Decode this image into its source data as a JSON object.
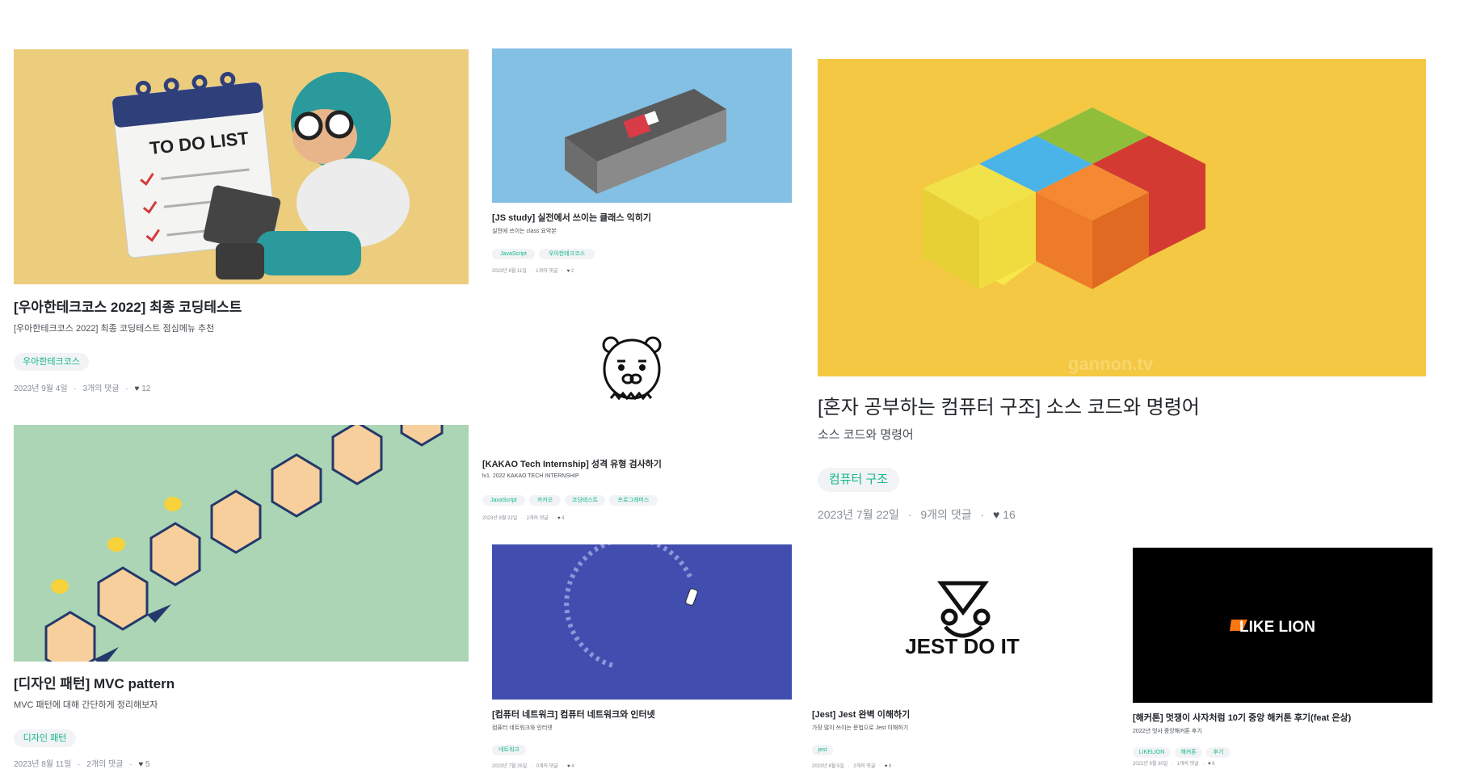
{
  "posts": [
    {
      "title": "[우아한테크코스 2022] 최종 코딩테스트",
      "desc": "[우아한테크코스 2022] 최종 코딩테스트 점심메뉴 추천",
      "tags": [
        "우아한테크코스"
      ],
      "date": "2023년 9월 4일",
      "comments": "3개의 댓글",
      "likes": "12",
      "thumb_text": "TO DO LIST"
    },
    {
      "title": "[디자인 패턴] MVC pattern",
      "desc": "MVC 패턴에 대해 간단하게 정리해보자",
      "tags": [
        "디자인 패턴"
      ],
      "date": "2023년 8월 11일",
      "comments": "2개의 댓글",
      "likes": "5"
    },
    {
      "title": "[JS study] 실전에서 쓰이는 클래스 익히기",
      "desc": "실전에 쓰이는 class 요약본",
      "tags": [
        "JavaScript",
        "우아한테크코스"
      ],
      "date": "2023년 8월 11일",
      "comments": "1개의 댓글",
      "likes": "2"
    },
    {
      "title": "[KAKAO Tech Internship] 성격 유형 검사하기",
      "desc": "lv1. 2022 KAKAO TECH INTERNSHIP",
      "tags": [
        "JavaScript",
        "카카오",
        "코딩테스트",
        "프로그래머스"
      ],
      "date": "2023년 8월 22일",
      "comments": "2개의 댓글",
      "likes": "4"
    },
    {
      "title": "[컴퓨터 네트워크] 컴퓨터 네트워크와 인터넷",
      "desc": "컴퓨터 네트워크와 인터넷",
      "tags": [
        "네트워크"
      ],
      "date": "2023년 7월 25일",
      "comments": "0개의 댓글",
      "likes": "4"
    },
    {
      "title": "[혼자 공부하는 컴퓨터 구조] 소스 코드와 명령어",
      "desc": "소스 코드와 명령어",
      "tags": [
        "컴퓨터 구조"
      ],
      "date": "2023년 7월 22일",
      "comments": "9개의 댓글",
      "likes": "16",
      "thumb_text": "gannon.tv"
    },
    {
      "title": "[Jest] Jest 완벽 이해하기",
      "desc": "가장 많이 쓰이는 문법으로 Jest 이해하기",
      "tags": [
        "jest"
      ],
      "date": "2023년 8월 5일",
      "comments": "2개의 댓글",
      "likes": "8",
      "thumb_text": "JEST DO IT"
    },
    {
      "title": "[해커톤] 멋쟁이 사자처럼 10기 중앙 해커톤 후기(feat 은상)",
      "desc": "2022년 멋사 중앙해커톤 후기",
      "tags": [
        "LIKELION",
        "해커톤",
        "후기"
      ],
      "date": "2022년 9월 30일",
      "comments": "1개의 댓글",
      "likes": "6",
      "thumb_text": "LIKE LION"
    }
  ],
  "separator": "·",
  "heart_icon": "heart-icon",
  "colors": {
    "tag_text": "#12b886",
    "tag_bg": "#f1f3f5",
    "thumb_todo": "#eccd7e",
    "thumb_mvc": "#abd5b5",
    "thumb_js": "#83c0e3",
    "thumb_network": "#414eb0",
    "thumb_lego": "#f4c842",
    "thumb_likelion": "#000000"
  }
}
